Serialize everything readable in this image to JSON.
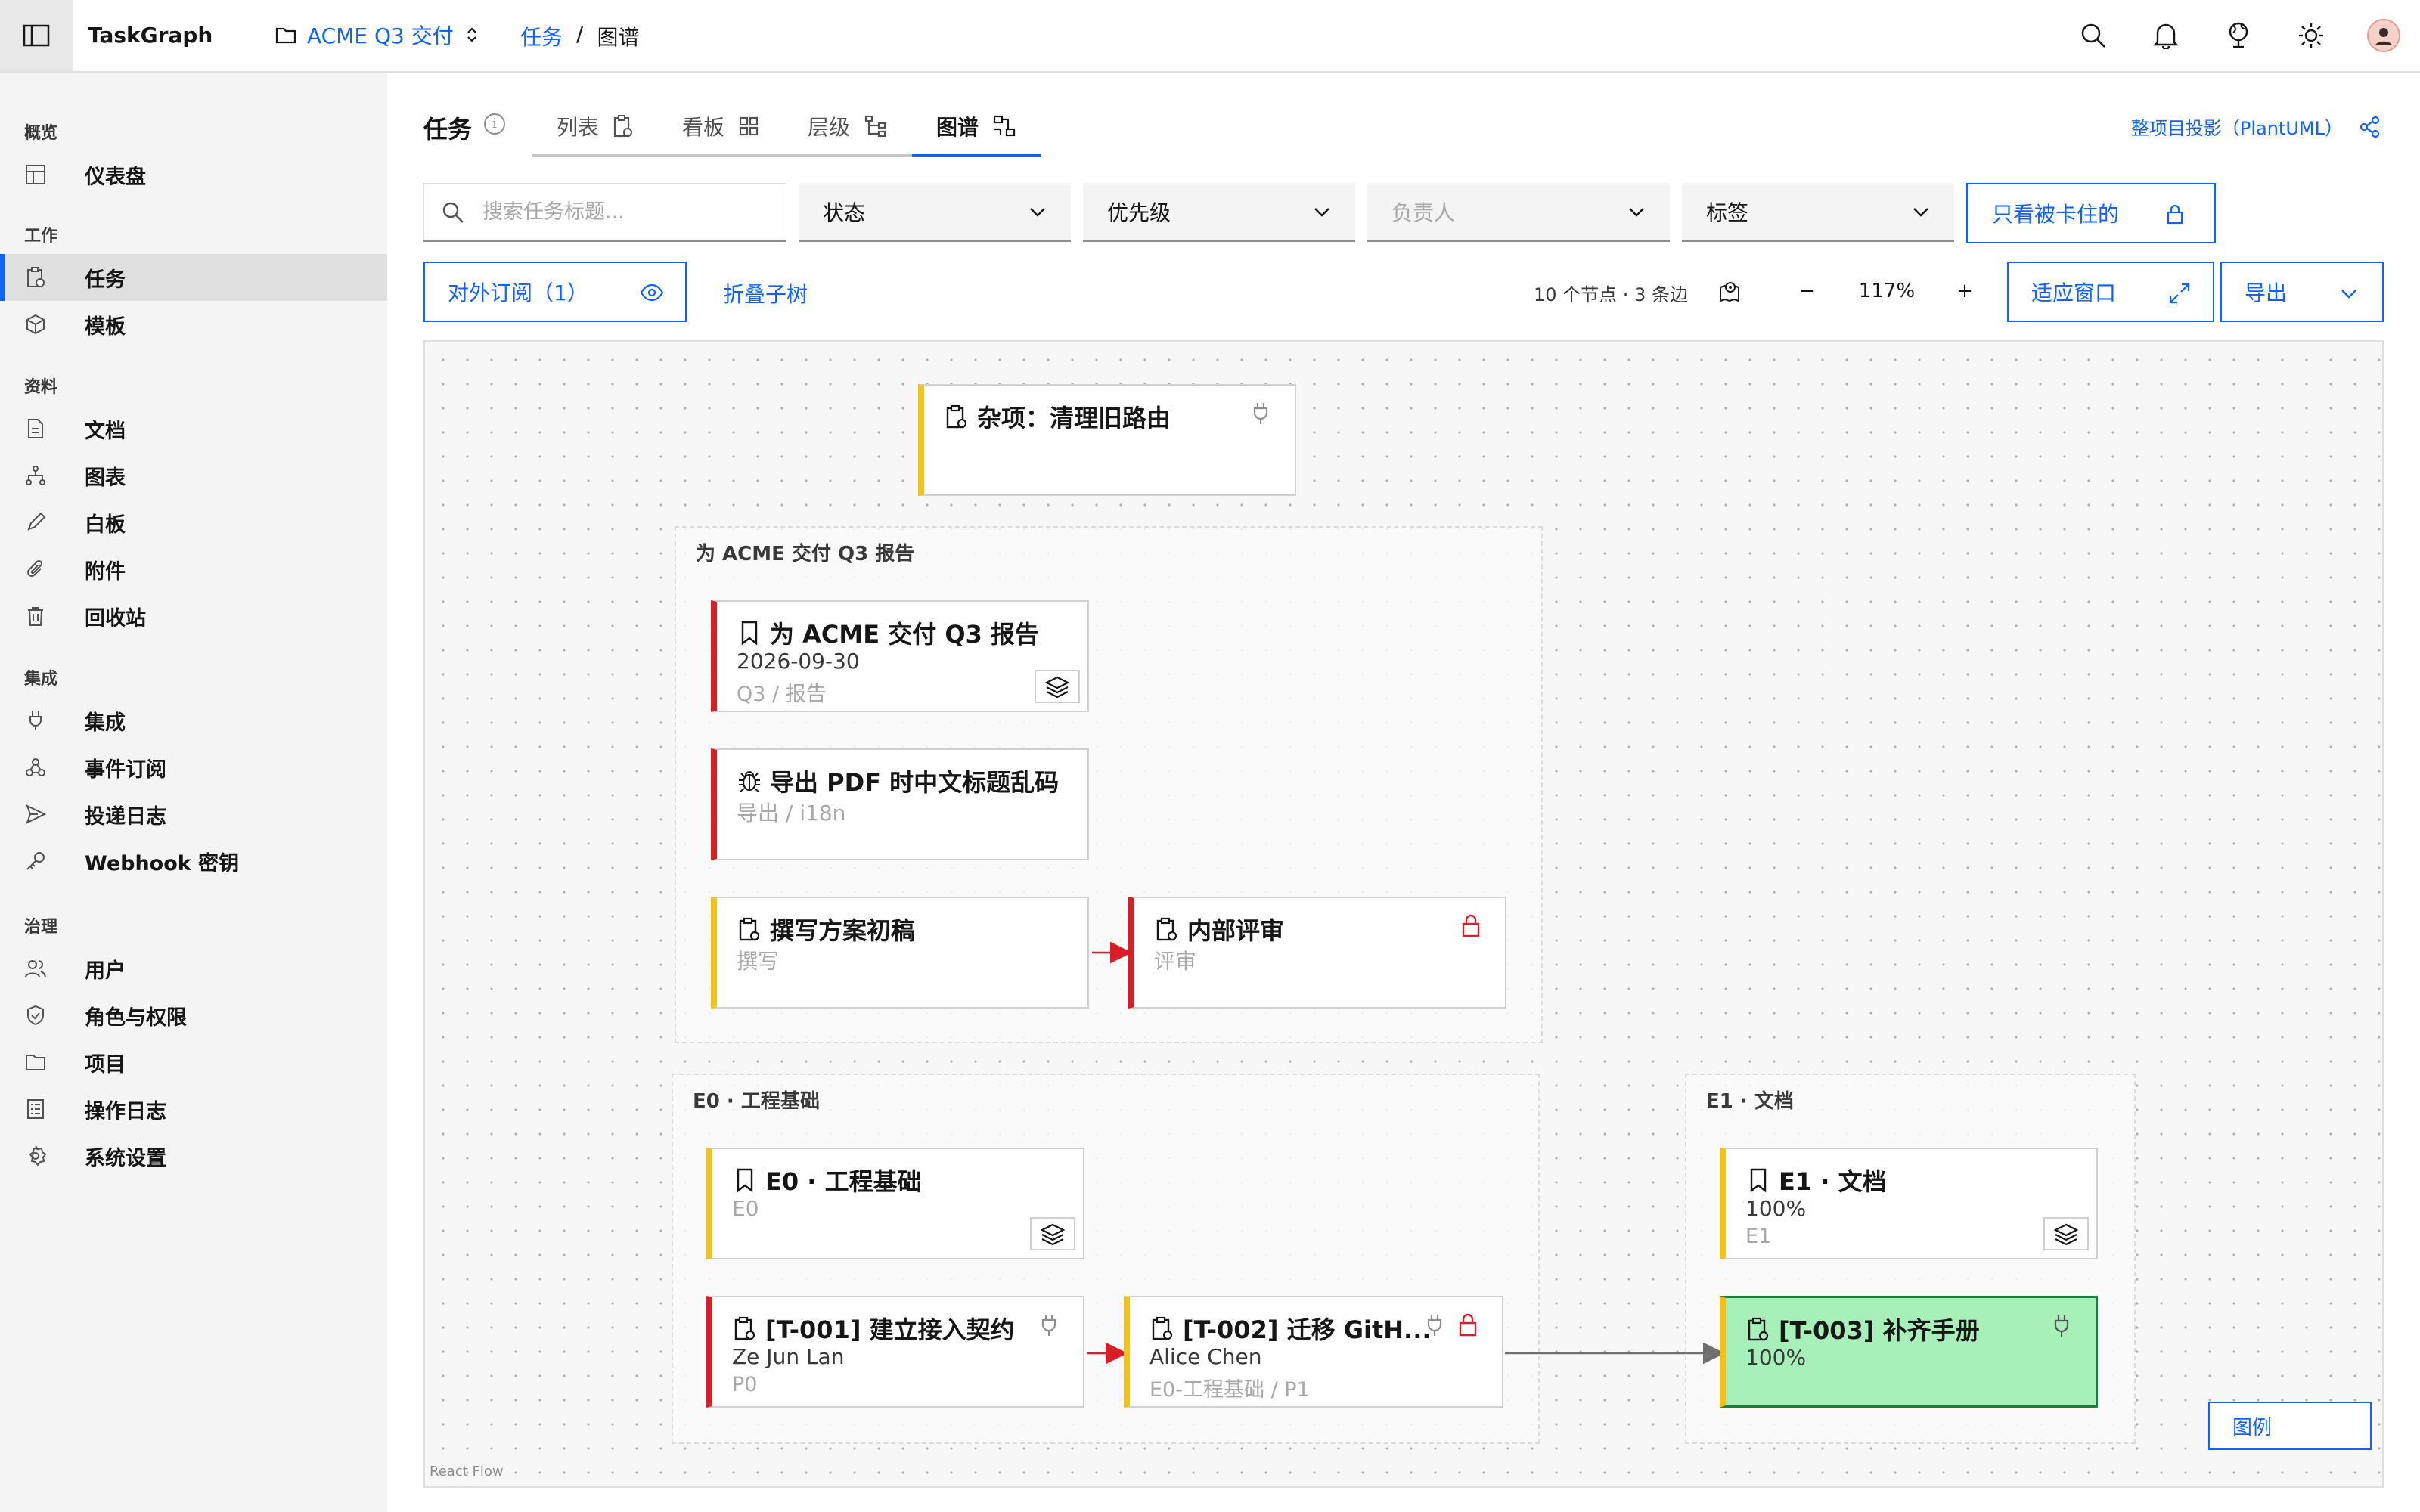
{
  "app": {
    "name": "TaskGraph"
  },
  "project": {
    "name": "ACME Q3 交付"
  },
  "breadcrumb": {
    "parent": "任务",
    "separator": "/",
    "current": "图谱"
  },
  "sidebar": {
    "sections": [
      {
        "title": "概览",
        "items": [
          {
            "label": "仪表盘",
            "icon": "dashboard-icon"
          }
        ]
      },
      {
        "title": "工作",
        "items": [
          {
            "label": "任务",
            "icon": "task-icon",
            "active": true
          },
          {
            "label": "模板",
            "icon": "cube-icon"
          }
        ]
      },
      {
        "title": "资料",
        "items": [
          {
            "label": "文档",
            "icon": "document-icon"
          },
          {
            "label": "图表",
            "icon": "diagram-icon"
          },
          {
            "label": "白板",
            "icon": "pencil-icon"
          },
          {
            "label": "附件",
            "icon": "paperclip-icon"
          },
          {
            "label": "回收站",
            "icon": "trash-icon"
          }
        ]
      },
      {
        "title": "集成",
        "items": [
          {
            "label": "集成",
            "icon": "plug-icon"
          },
          {
            "label": "事件订阅",
            "icon": "webhook-icon"
          },
          {
            "label": "投递日志",
            "icon": "send-icon"
          },
          {
            "label": "Webhook 密钥",
            "icon": "key-icon"
          }
        ]
      },
      {
        "title": "治理",
        "items": [
          {
            "label": "用户",
            "icon": "users-icon"
          },
          {
            "label": "角色与权限",
            "icon": "shield-icon"
          },
          {
            "label": "项目",
            "icon": "folder-icon"
          },
          {
            "label": "操作日志",
            "icon": "log-icon"
          },
          {
            "label": "系统设置",
            "icon": "settings-icon"
          }
        ]
      }
    ]
  },
  "main": {
    "title": "任务",
    "tabs": [
      {
        "label": "列表"
      },
      {
        "label": "看板"
      },
      {
        "label": "层级"
      },
      {
        "label": "图谱",
        "active": true
      }
    ],
    "project_projection": "整项目投影（PlantUML）"
  },
  "filters": {
    "search_placeholder": "搜索任务标题...",
    "status": "状态",
    "priority": "优先级",
    "assignee": "负责人",
    "tags": "标签",
    "blocked_only": "只看被卡住的"
  },
  "toolbar": {
    "subscribe": "对外订阅（1）",
    "collapse": "折叠子树",
    "stats": "10 个节点 · 3 条边",
    "zoom": "117%",
    "zoom_out": "−",
    "zoom_in": "+",
    "fit": "适应窗口",
    "export": "导出"
  },
  "graph": {
    "groups": [
      {
        "label": "为 ACME 交付 Q3 报告"
      },
      {
        "label": "E0 · 工程基础"
      },
      {
        "label": "E1 · 文档"
      }
    ],
    "nodes": [
      {
        "title": "杂项：清理旧路由",
        "line2": "",
        "line3": "",
        "kind": "task",
        "accent": "yellow",
        "integration": true
      },
      {
        "title": "为 ACME 交付 Q3 报告",
        "line2": "2026-09-30",
        "line3": "Q3 / 报告",
        "kind": "epic",
        "accent": "red"
      },
      {
        "title": "导出 PDF 时中文标题乱码",
        "line2": "导出 / i18n",
        "kind": "bug",
        "accent": "red"
      },
      {
        "title": "撰写方案初稿",
        "line2": "撰写",
        "kind": "task",
        "accent": "yellow"
      },
      {
        "title": "内部评审",
        "line2": "评审",
        "kind": "task",
        "accent": "red",
        "locked": true
      },
      {
        "title": "E0 · 工程基础",
        "line2": "E0",
        "kind": "epic",
        "accent": "yellow"
      },
      {
        "title": "[T-001] 建立接入契约",
        "line2": "Ze Jun Lan",
        "line3": "P0",
        "kind": "task",
        "accent": "red",
        "integration": true
      },
      {
        "title": "[T-002] 迁移 GitH...",
        "line2": "Alice Chen",
        "line3": "E0-工程基础 / P1",
        "kind": "task",
        "accent": "yellow",
        "integration": true,
        "locked": true
      },
      {
        "title": "E1 · 文档",
        "line2": "100%",
        "line3": "E1",
        "kind": "epic",
        "accent": "yellow"
      },
      {
        "title": "[T-003] 补齐手册",
        "line2": "100%",
        "kind": "task",
        "accent": "yellow",
        "integration": true,
        "done": true
      }
    ],
    "legend": "图例",
    "attribution": "React Flow"
  },
  "colors": {
    "primary": "#0f62fe",
    "danger": "#da1e28",
    "warning": "#f1c21b",
    "done_bg": "#a7f0ba",
    "done_border": "#198038"
  }
}
